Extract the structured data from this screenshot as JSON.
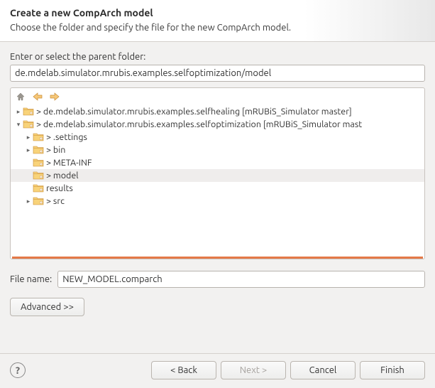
{
  "header": {
    "title": "Create a new CompArch model",
    "subtitle": "Choose the folder and specify the file for the new CompArch model."
  },
  "parent_folder": {
    "label": "Enter or select the parent folder:",
    "value": "de.mdelab.simulator.mrubis.examples.selfoptimization/model"
  },
  "tree": {
    "items": [
      {
        "label": "> de.mdelab.simulator.mrubis.examples.selfhealing [mRUBiS_Simulator master]",
        "level": 0,
        "expander": "▸",
        "selected": false
      },
      {
        "label": "> de.mdelab.simulator.mrubis.examples.selfoptimization [mRUBiS_Simulator mast",
        "level": 0,
        "expander": "▾",
        "selected": false
      },
      {
        "label": "> .settings",
        "level": 1,
        "expander": "▸",
        "selected": false
      },
      {
        "label": "> bin",
        "level": 1,
        "expander": "▸",
        "selected": false
      },
      {
        "label": "> META-INF",
        "level": 1,
        "expander": "",
        "selected": false
      },
      {
        "label": "> model",
        "level": 1,
        "expander": "",
        "selected": true
      },
      {
        "label": "results",
        "level": 1,
        "expander": "",
        "selected": false
      },
      {
        "label": "> src",
        "level": 1,
        "expander": "▸",
        "selected": false
      }
    ]
  },
  "file_name": {
    "label": "File name:",
    "value": "NEW_MODEL.comparch"
  },
  "buttons": {
    "advanced": "Advanced >>",
    "back": "< Back",
    "next": "Next >",
    "cancel": "Cancel",
    "finish": "Finish"
  },
  "icons": {
    "home": "home-icon",
    "back_arrow": "back-arrow-icon",
    "forward_arrow": "forward-arrow-icon",
    "help": "?"
  }
}
